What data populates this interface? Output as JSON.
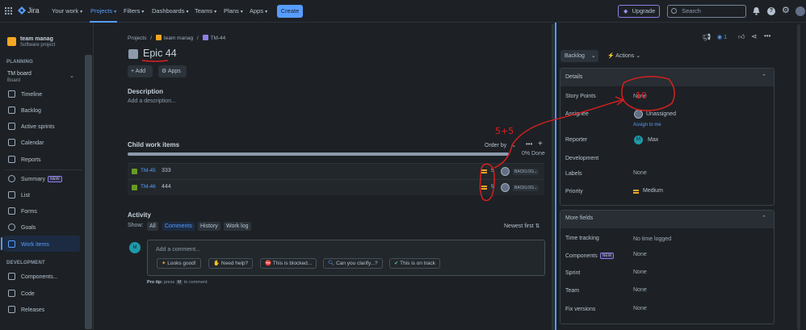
{
  "topbar": {
    "logo": "Jira",
    "nav": [
      "Your work",
      "Projects",
      "Filters",
      "Dashboards",
      "Teams",
      "Plans",
      "Apps"
    ],
    "create": "Create",
    "upgrade": "Upgrade",
    "search_placeholder": "Search"
  },
  "sidebar": {
    "project_name": "team manag",
    "project_type": "Software project",
    "planning_heading": "PLANNING",
    "board_name": "TM board",
    "board_sub": "Board",
    "planning_items": [
      "Timeline",
      "Backlog",
      "Active sprints",
      "Calendar",
      "Reports"
    ],
    "items": [
      "Summary",
      "List",
      "Forms",
      "Goals",
      "Work items"
    ],
    "new_badge": "NEW",
    "development_heading": "DEVELOPMENT",
    "dev_items": [
      "Components...",
      "Code",
      "Releases"
    ]
  },
  "breadcrumb": [
    "Projects",
    "team manag",
    "TM-44"
  ],
  "issue": {
    "title": "Epic 44",
    "add_button": "Add",
    "apps_button": "Apps",
    "description_heading": "Description",
    "description_placeholder": "Add a description..."
  },
  "child_items": {
    "heading": "Child work items",
    "order_by": "Order by",
    "progress_text": "0% Done",
    "progress_fraction": 0,
    "rows": [
      {
        "key": "TM-45",
        "summary": "333",
        "points": "5",
        "status": "BACKLOG"
      },
      {
        "key": "TM-46",
        "summary": "444",
        "points": "5",
        "status": "BACKLOG"
      }
    ]
  },
  "activity": {
    "heading": "Activity",
    "show_label": "Show:",
    "tabs": [
      "All",
      "Comments",
      "History",
      "Work log"
    ],
    "sort": "Newest first",
    "avatar_initial": "M",
    "comment_placeholder": "Add a comment...",
    "quick_replies": [
      "Looks good!",
      "Need help?",
      "This is blocked...",
      "Can you clarify...?",
      "This is on track"
    ],
    "pro_tip_prefix": "Pro tip:",
    "pro_tip_text": "press",
    "pro_tip_key": "M",
    "pro_tip_suffix": "to comment"
  },
  "right_panel": {
    "watch_count": "1",
    "status_button": "Backlog",
    "actions_button": "Actions",
    "details_heading": "Details",
    "fields": [
      {
        "label": "Story Points",
        "value": "None"
      },
      {
        "label": "Assignee",
        "value": "Unassigned"
      },
      {
        "label": "Reporter",
        "value": "Max"
      },
      {
        "label": "Development",
        "value": ""
      },
      {
        "label": "Labels",
        "value": "None"
      },
      {
        "label": "Priority",
        "value": "Medium"
      }
    ],
    "assign_to_me": "Assign to me",
    "reporter_initial": "M",
    "more_fields_heading": "More fields",
    "more_fields": [
      {
        "label": "Time tracking",
        "value": "No time logged"
      },
      {
        "label": "Components",
        "value": "None",
        "badge": "NEW"
      },
      {
        "label": "Sprint",
        "value": "None"
      },
      {
        "label": "Team",
        "value": "None"
      },
      {
        "label": "Fix versions",
        "value": "None"
      }
    ]
  },
  "annotations": {
    "sum_label": "5+5",
    "total_label": "10",
    "color": "#e01f1f"
  },
  "colors": {
    "accent": "#579dff",
    "background": "#1d2125",
    "story_icon": "#6a9a23",
    "epic_icon": "#8f7ee7",
    "project_icon": "#f5a623"
  }
}
